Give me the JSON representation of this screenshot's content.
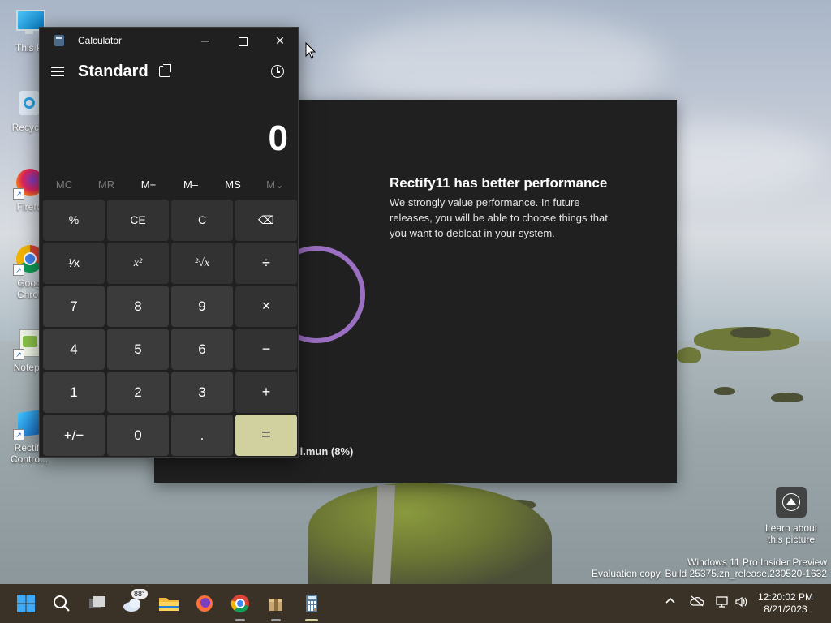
{
  "desktop": {
    "icons": [
      {
        "label": "This P",
        "name": "this-pc"
      },
      {
        "label": "Recycle",
        "name": "recycle-bin"
      },
      {
        "label": "Firefo",
        "name": "firefox"
      },
      {
        "label": "Goog\nChror",
        "name": "google-chrome"
      },
      {
        "label": "Notepa",
        "name": "notepad"
      },
      {
        "label": "Rectify\nContro...",
        "name": "rectify-control"
      }
    ],
    "learn_label": "Learn about\nthis picture",
    "watermark_line1": "Windows 11 Pro Insider Preview",
    "watermark_line2": "Evaluation copy. Build 25375.zn_release.230520-1632"
  },
  "calculator": {
    "window_title": "Calculator",
    "mode": "Standard",
    "display": "0",
    "memory": [
      {
        "label": "MC",
        "enabled": false
      },
      {
        "label": "MR",
        "enabled": false
      },
      {
        "label": "M+",
        "enabled": true
      },
      {
        "label": "M–",
        "enabled": true
      },
      {
        "label": "MS",
        "enabled": true
      },
      {
        "label": "M⌄",
        "enabled": false
      }
    ],
    "keys": {
      "percent": "%",
      "ce": "CE",
      "c": "C",
      "backspace": "⌫",
      "reciprocal": "¹⁄x",
      "square": "x²",
      "sqrt": "²√x",
      "divide": "÷",
      "seven": "7",
      "eight": "8",
      "nine": "9",
      "multiply": "×",
      "four": "4",
      "five": "5",
      "six": "6",
      "minus": "−",
      "one": "1",
      "two": "2",
      "three": "3",
      "plus": "+",
      "negate": "+/−",
      "zero": "0",
      "decimal": ".",
      "equals": "="
    }
  },
  "rectify_dialog": {
    "heading": "Rectify11 has better performance",
    "body": "We strongly value performance. In future releases, you will be able to choose things that you want to debloat in your system.",
    "progress_text": "ll.mun (8%)"
  },
  "taskbar": {
    "weather_temp": "88°",
    "time": "12:20:02 PM",
    "date": "8/21/2023"
  }
}
